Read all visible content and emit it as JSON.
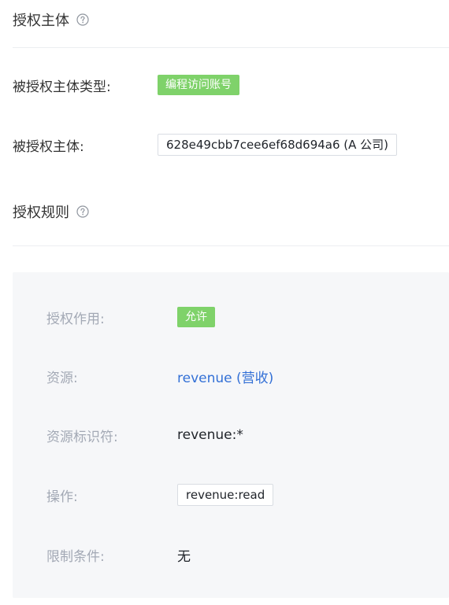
{
  "principal_section": {
    "title": "授权主体",
    "type_label": "被授权主体类型:",
    "type_tag": "编程访问账号",
    "principal_label": "被授权主体:",
    "principal_value": "628e49cbb7cee6ef68d694a6 (A 公司)"
  },
  "rules_section": {
    "title": "授权规则",
    "effect_label": "授权作用:",
    "effect_tag": "允许",
    "resource_label": "资源:",
    "resource_value": "revenue (营收)",
    "resource_id_label": "资源标识符:",
    "resource_id_value": "revenue:*",
    "action_label": "操作:",
    "action_value": "revenue:read",
    "condition_label": "限制条件:",
    "condition_value": "无"
  },
  "colors": {
    "tag_green": "#7fd26a",
    "link_blue": "#3370d6",
    "card_bg": "#f6f7f9",
    "muted_label": "#a3a9b5"
  },
  "icons": {
    "help": "question-circle-icon"
  }
}
